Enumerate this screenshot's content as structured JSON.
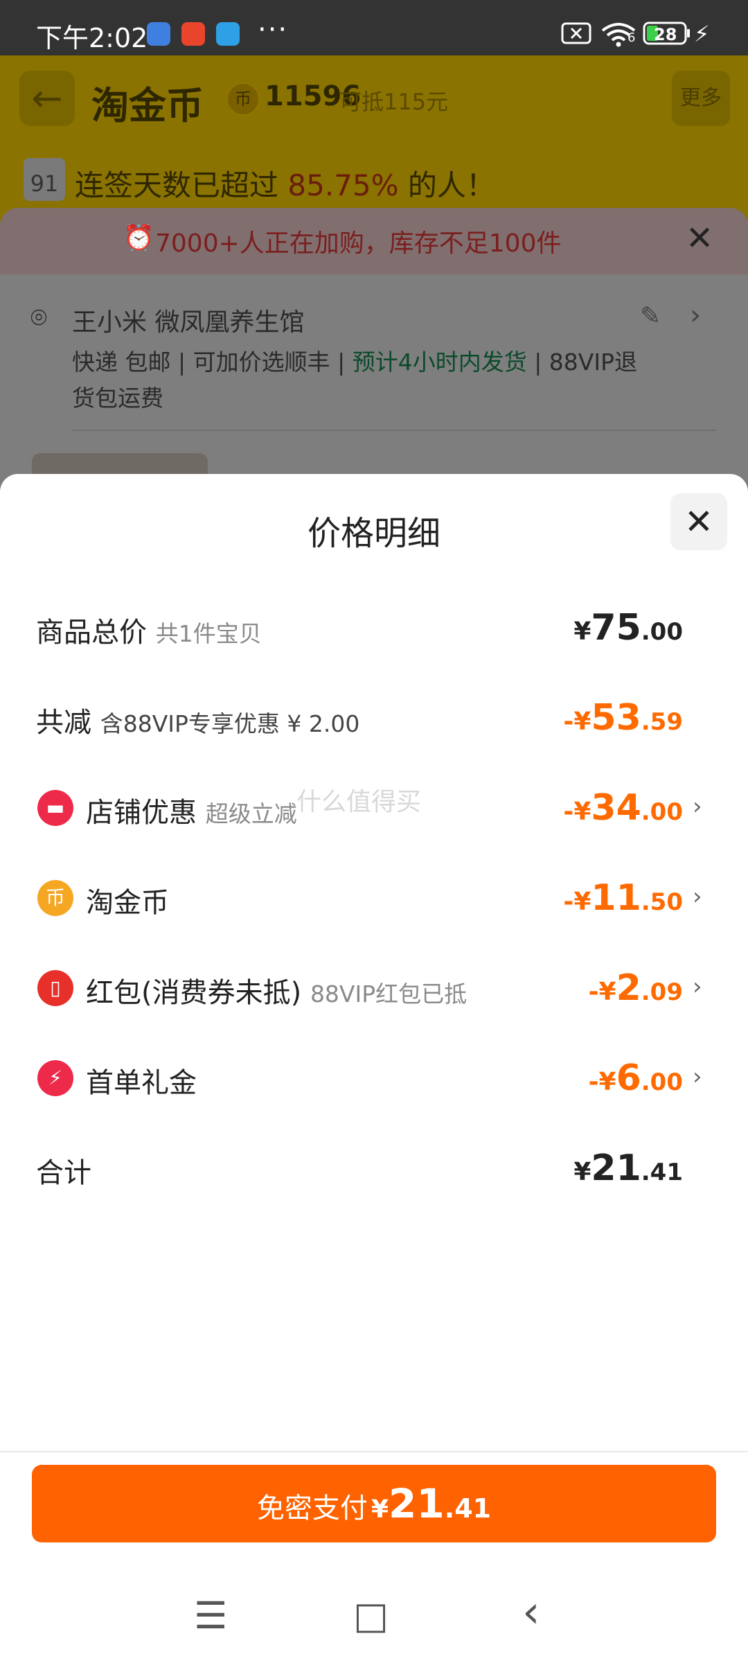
{
  "status_bar": {
    "time": "下午2:02",
    "more": "···",
    "wifi_badge": "6",
    "battery": "28"
  },
  "background": {
    "title": "淘金币",
    "coin_count": "11596",
    "coin_value": "可抵115元",
    "more": "更多",
    "calendar_day": "91",
    "streak_prefix": "连签天数已超过",
    "streak_percent": "85.75%",
    "streak_suffix": "的人！",
    "alert": "7000+人正在加购，库存不足100件",
    "address": "王小米 微凤凰养生馆",
    "shipping_line1_a": "快递 包邮 | 可加价选顺丰 |",
    "shipping_line1_green": "预计4小时内发货",
    "shipping_line1_b": "| 88VIP退",
    "shipping_line2": "货包运费"
  },
  "modal": {
    "title": "价格明细",
    "rows": [
      {
        "label": "商品总价",
        "sub": "共1件宝贝",
        "yen": "¥",
        "int": "75",
        "dec": ".00"
      },
      {
        "label": "共减",
        "sub": "含88VIP专享优惠 ¥ 2.00",
        "yen": "-¥",
        "int": "53",
        "dec": ".59"
      },
      {
        "label": "店铺优惠",
        "sub": "超级立减",
        "yen": "-¥",
        "int": "34",
        "dec": ".00"
      },
      {
        "label": "淘金币",
        "sub": "",
        "yen": "-¥",
        "int": "11",
        "dec": ".50"
      },
      {
        "label": "红包(消费券未抵)",
        "sub": "88VIP红包已抵",
        "yen": "-¥",
        "int": "2",
        "dec": ".09"
      },
      {
        "label": "首单礼金",
        "sub": "",
        "yen": "-¥",
        "int": "6",
        "dec": ".00"
      },
      {
        "label": "合计",
        "sub": "",
        "yen": "¥",
        "int": "21",
        "dec": ".41"
      }
    ],
    "watermark": "什么值得买",
    "pay_button": {
      "text": "免密支付",
      "yen": "¥",
      "int": "21",
      "dec": ".41"
    }
  },
  "colors": {
    "accent_orange": "#ff6a00",
    "pay_button": "#ff6200",
    "shop_icon": "#ee2a4a",
    "coin_icon": "#f5a623",
    "redpacket_icon": "#e8302a",
    "firstorder_icon": "#ee2a4a"
  },
  "icons": {
    "nav_menu": "☰",
    "nav_home": "□",
    "nav_back": "‹"
  }
}
